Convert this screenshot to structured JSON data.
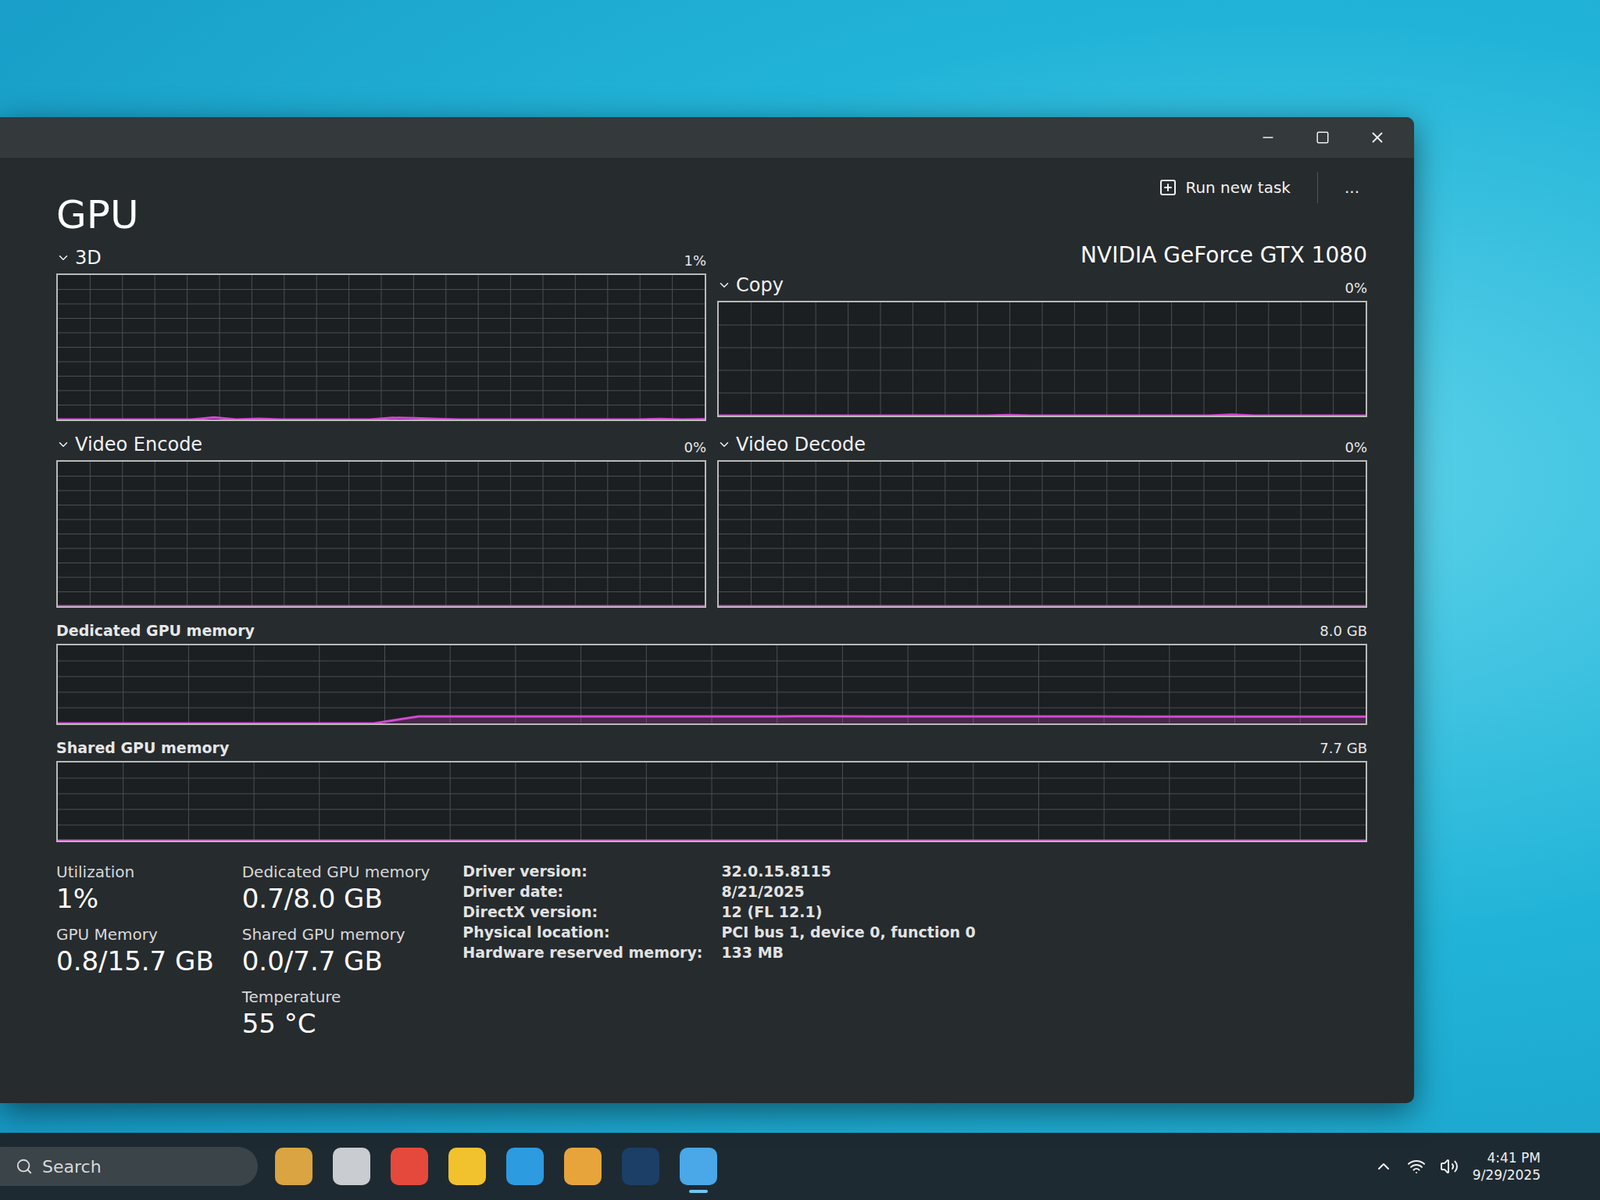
{
  "header": {
    "title": "GPU",
    "run_new_task": "Run new task",
    "more": "...",
    "device": "NVIDIA GeForce GTX 1080"
  },
  "engines": [
    {
      "name": "3D",
      "reading": "1%",
      "expanded": true,
      "values": [
        0,
        0,
        0,
        0,
        0,
        0,
        0,
        1.5,
        0,
        0.6,
        0,
        0,
        0,
        0,
        0,
        1.2,
        1,
        0.4,
        0,
        0,
        0,
        0,
        0,
        0,
        0,
        0,
        0,
        0.4,
        0,
        0.3
      ]
    },
    {
      "name": "Copy",
      "reading": "0%",
      "expanded": true,
      "values": [
        0,
        0,
        0,
        0,
        0,
        0,
        0,
        0,
        0,
        0,
        0,
        0,
        0,
        0.6,
        0,
        0,
        0,
        0,
        0,
        0,
        0,
        0,
        0,
        0.8,
        0,
        0,
        0,
        0,
        0,
        0
      ]
    },
    {
      "name": "Video Encode",
      "reading": "0%",
      "expanded": true,
      "values": [
        0,
        0,
        0,
        0,
        0,
        0,
        0,
        0,
        0,
        0,
        0,
        0,
        0,
        0,
        0,
        0,
        0,
        0,
        0,
        0,
        0,
        0,
        0,
        0,
        0,
        0,
        0,
        0,
        0,
        0
      ]
    },
    {
      "name": "Video Decode",
      "reading": "0%",
      "expanded": true,
      "values": [
        0,
        0,
        0,
        0,
        0,
        0,
        0,
        0,
        0,
        0,
        0,
        0,
        0,
        0,
        0,
        0,
        0,
        0,
        0,
        0,
        0,
        0,
        0,
        0,
        0,
        0,
        0,
        0,
        0,
        0
      ]
    }
  ],
  "memory_charts": [
    {
      "name": "Dedicated GPU memory",
      "max": "8.0 GB",
      "capacity": 8,
      "values": [
        0,
        0,
        0,
        0,
        0,
        0,
        0,
        0,
        0.72,
        0.73,
        0.73,
        0.73,
        0.73,
        0.73,
        0.73,
        0.73,
        0.73,
        0.74,
        0.73,
        0.73,
        0.73,
        0.73,
        0.72,
        0.72,
        0.71,
        0.71,
        0.7,
        0.7,
        0.7,
        0.7
      ]
    },
    {
      "name": "Shared GPU memory",
      "max": "7.7 GB",
      "capacity": 7.7,
      "values": [
        0,
        0,
        0,
        0,
        0,
        0,
        0,
        0,
        0,
        0,
        0,
        0,
        0,
        0,
        0,
        0,
        0,
        0,
        0,
        0,
        0,
        0,
        0,
        0,
        0,
        0,
        0,
        0,
        0,
        0
      ]
    }
  ],
  "stat_columns": [
    [
      {
        "label": "Utilization",
        "value": "1%"
      },
      {
        "label": "GPU Memory",
        "value": "0.8/15.7 GB"
      }
    ],
    [
      {
        "label": "Dedicated GPU memory",
        "value": "0.7/8.0 GB"
      },
      {
        "label": "Shared GPU memory",
        "value": "0.0/7.7 GB"
      },
      {
        "label": "Temperature",
        "value": "55 °C"
      }
    ]
  ],
  "details": [
    {
      "label": "Driver version:",
      "value": "32.0.15.8115"
    },
    {
      "label": "Driver date:",
      "value": "8/21/2025"
    },
    {
      "label": "DirectX version:",
      "value": "12 (FL 12.1)"
    },
    {
      "label": "Physical location:",
      "value": "PCI bus 1, device 0, function 0"
    },
    {
      "label": "Hardware reserved memory:",
      "value": "133 MB"
    }
  ],
  "taskbar": {
    "search": "Search",
    "time": "4:41 PM",
    "date": "9/29/2025",
    "apps": [
      {
        "color": "#d9a441",
        "selected": false
      },
      {
        "color": "#c9ccd0",
        "selected": false
      },
      {
        "color": "#e4493c",
        "selected": false
      },
      {
        "color": "#f2c12e",
        "selected": false
      },
      {
        "color": "#2d9be0",
        "selected": false
      },
      {
        "color": "#e7a43a",
        "selected": false
      },
      {
        "color": "#1b3f66",
        "selected": false
      },
      {
        "color": "#4aa7e8",
        "selected": true
      }
    ]
  }
}
